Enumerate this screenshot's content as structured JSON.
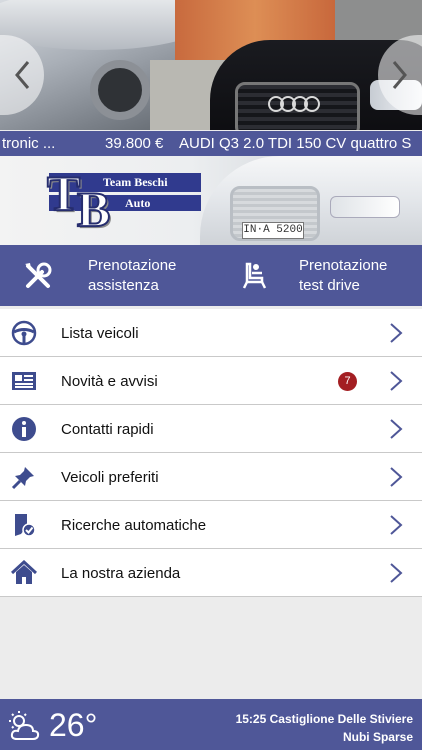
{
  "carousel": {
    "ticker_left": "tronic ...",
    "ticker_price": "39.800 €",
    "ticker_title": "AUDI Q3 2.0 TDI 150 CV quattro S",
    "prev_icon": "chevron-left-icon",
    "next_icon": "chevron-right-icon"
  },
  "hero_plate": "IN·A 5200",
  "logo": {
    "letter_t": "T",
    "letter_b": "B",
    "line1": "Team Beschi",
    "line2": "Auto"
  },
  "booking": {
    "assistance": {
      "line1": "Prenotazione",
      "line2": "assistenza",
      "icon": "tools-icon"
    },
    "test_drive": {
      "line1": "Prenotazione",
      "line2": "test drive",
      "icon": "car-seat-icon"
    }
  },
  "menu": [
    {
      "label": "Lista veicoli",
      "icon": "steering-wheel-icon"
    },
    {
      "label": "Novità e avvisi",
      "icon": "newspaper-icon",
      "badge": "7"
    },
    {
      "label": "Contatti rapidi",
      "icon": "info-icon"
    },
    {
      "label": "Veicoli preferiti",
      "icon": "pin-icon"
    },
    {
      "label": "Ricerche automatiche",
      "icon": "bookmark-check-icon"
    },
    {
      "label": "La nostra azienda",
      "icon": "home-icon"
    }
  ],
  "weather": {
    "temperature": "26°",
    "time_location": "15:25 Castiglione Delle Stiviere",
    "condition": "Nubi Sparse",
    "icon": "partly-cloudy-icon"
  },
  "colors": {
    "brand_blue": "#4f5798",
    "badge_red": "#a31e22",
    "icon_blue": "#3e4c8e"
  }
}
